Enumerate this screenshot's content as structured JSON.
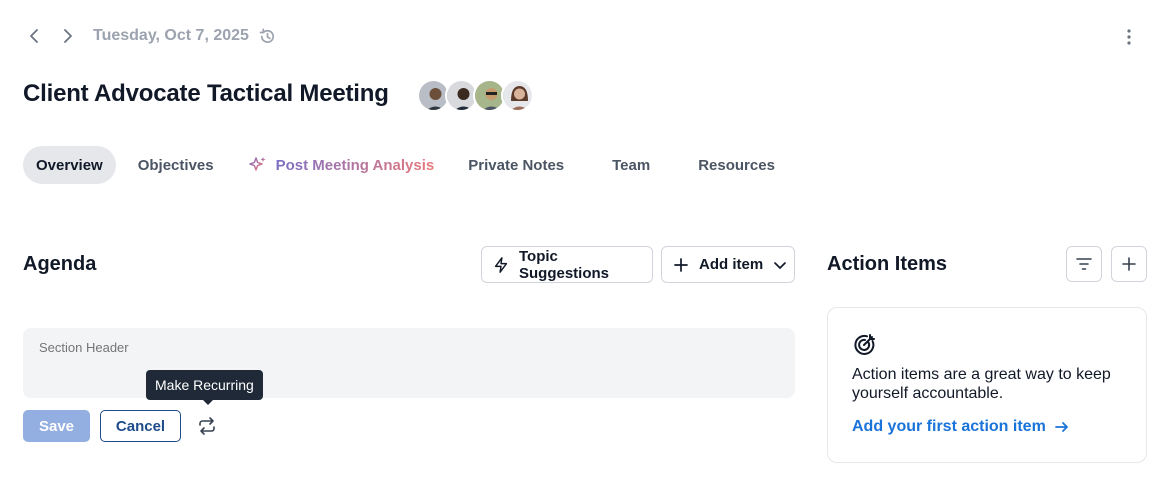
{
  "header": {
    "date": "Tuesday, Oct 7, 2025"
  },
  "meeting": {
    "title": "Client Advocate Tactical Meeting",
    "attendees": [
      {
        "name": "attendee-1",
        "bg": "#9ca3af",
        "skin": "#6b4f3a"
      },
      {
        "name": "attendee-2",
        "bg": "#d1d5db",
        "skin": "#3b2a20"
      },
      {
        "name": "attendee-3",
        "bg": "#a7b58a",
        "skin": "#c69a6d"
      },
      {
        "name": "attendee-4",
        "bg": "#e5e7eb",
        "skin": "#d8b39a"
      }
    ]
  },
  "tabs": [
    {
      "label": "Overview",
      "active": true
    },
    {
      "label": "Objectives"
    },
    {
      "label": "Post Meeting Analysis",
      "icon": "sparkle-icon"
    },
    {
      "label": "Private Notes"
    },
    {
      "label": "Team"
    },
    {
      "label": "Resources"
    }
  ],
  "agenda": {
    "title": "Agenda",
    "topic_suggestions_label": "Topic Suggestions",
    "add_item_label": "Add item",
    "section_header_placeholder": "Section Header",
    "tooltip": "Make Recurring",
    "save_label": "Save",
    "cancel_label": "Cancel"
  },
  "action_items": {
    "title": "Action Items",
    "empty_text": "Action items are a great way to keep yourself accountable.",
    "link_label": "Add your first action item"
  },
  "colors": {
    "primary": "#1e4c8a",
    "link": "#1a73d9",
    "save_disabled": "#93aee0",
    "muted": "#9ca3af"
  }
}
